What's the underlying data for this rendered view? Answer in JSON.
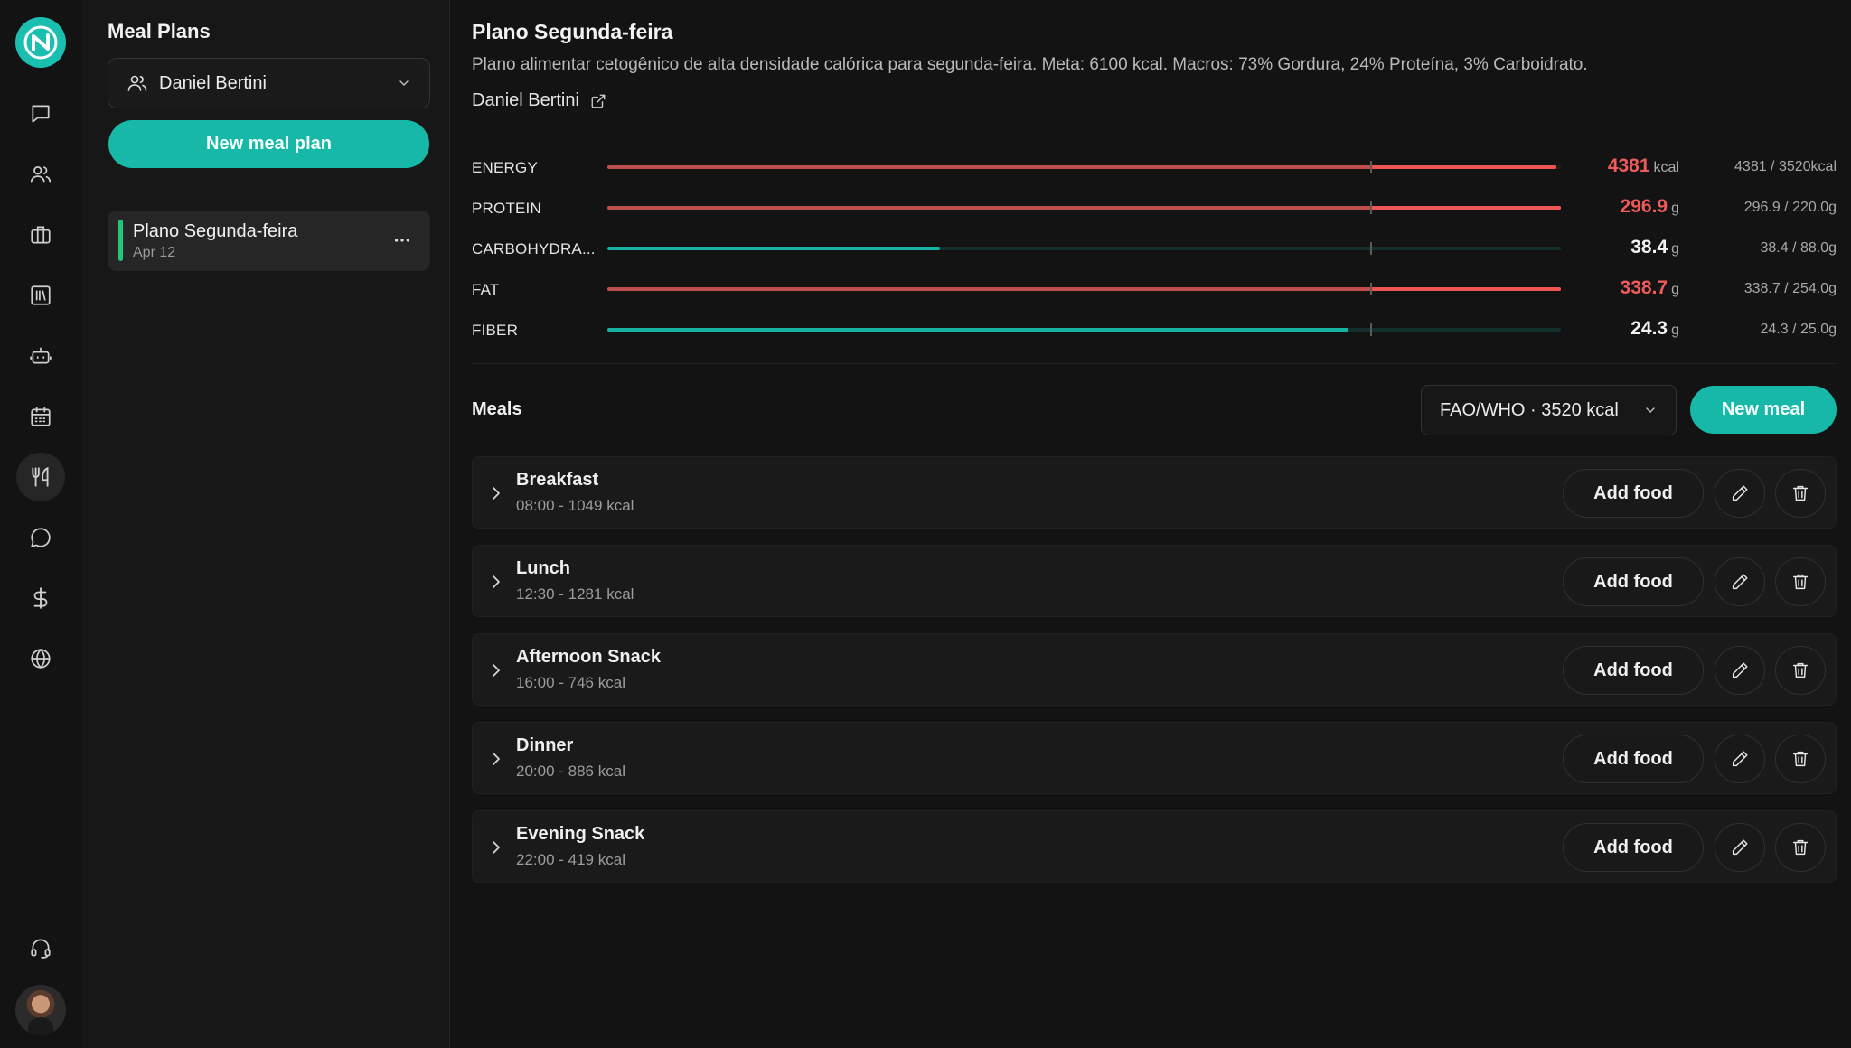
{
  "sidebar": {
    "title": "Meal Plans",
    "client_select": "Daniel Bertini",
    "new_plan_label": "New meal plan",
    "plans": [
      {
        "name": "Plano Segunda-feira",
        "date": "Apr 12"
      }
    ]
  },
  "plan": {
    "title": "Plano Segunda-feira",
    "description": "Plano alimentar cetogênico de alta densidade calórica para segunda-feira. Meta: 6100 kcal. Macros: 73% Gordura, 24% Proteína, 3% Carboidrato.",
    "client": "Daniel Bertini"
  },
  "nutrients": [
    {
      "label": "ENERGY",
      "value": "4381",
      "unit": "kcal",
      "ratio": "4381 / 3520kcal",
      "current": 4381,
      "target": 3520,
      "over": true
    },
    {
      "label": "PROTEIN",
      "value": "296.9",
      "unit": "g",
      "ratio": "296.9 / 220.0g",
      "current": 296.9,
      "target": 220.0,
      "over": true
    },
    {
      "label": "CARBOHYDRA...",
      "value": "38.4",
      "unit": "g",
      "ratio": "38.4 / 88.0g",
      "current": 38.4,
      "target": 88.0,
      "over": false
    },
    {
      "label": "FAT",
      "value": "338.7",
      "unit": "g",
      "ratio": "338.7 / 254.0g",
      "current": 338.7,
      "target": 254.0,
      "over": true
    },
    {
      "label": "FIBER",
      "value": "24.3",
      "unit": "g",
      "ratio": "24.3 / 25.0g",
      "current": 24.3,
      "target": 25.0,
      "over": false
    }
  ],
  "meals_section": {
    "title": "Meals",
    "standard_select": "FAO/WHO · 3520 kcal",
    "new_meal_label": "New meal",
    "add_food_label": "Add food"
  },
  "meals": [
    {
      "name": "Breakfast",
      "meta": "08:00 - 1049 kcal"
    },
    {
      "name": "Lunch",
      "meta": "12:30 - 1281 kcal"
    },
    {
      "name": "Afternoon Snack",
      "meta": "16:00 - 746 kcal"
    },
    {
      "name": "Dinner",
      "meta": "20:00 - 886 kcal"
    },
    {
      "name": "Evening Snack",
      "meta": "22:00 - 419 kcal"
    }
  ],
  "colors": {
    "accent": "#17b8a8",
    "over": "#ef5a5a",
    "background": "#131313"
  },
  "rail_icons": [
    "chat-icon",
    "users-icon",
    "briefcase-icon",
    "library-icon",
    "robot-icon",
    "calendar-icon",
    "utensils-icon",
    "message-circle-icon",
    "dollar-icon",
    "globe-icon",
    "headset-icon"
  ]
}
